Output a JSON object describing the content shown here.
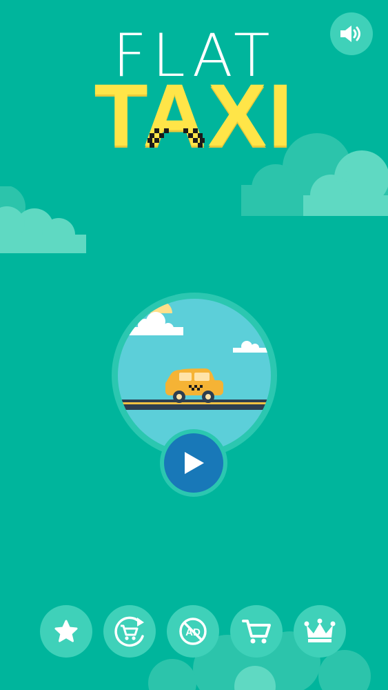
{
  "title": {
    "line1": "FLAT",
    "line2": "TAXI"
  },
  "icons": {
    "sound": "speaker-volume-icon",
    "play": "play-icon",
    "rate": "star-icon",
    "restore_purchases": "restore-cart-icon",
    "remove_ads": "no-ads-icon",
    "shop": "shopping-cart-icon",
    "leaderboard": "crown-icon"
  },
  "remove_ads_label": "AD",
  "colors": {
    "background": "#00B59C",
    "button": "#3FD1B9",
    "title_yellow": "#FFE548",
    "play_blue": "#1878B8",
    "taxi_orange": "#F5B335"
  }
}
